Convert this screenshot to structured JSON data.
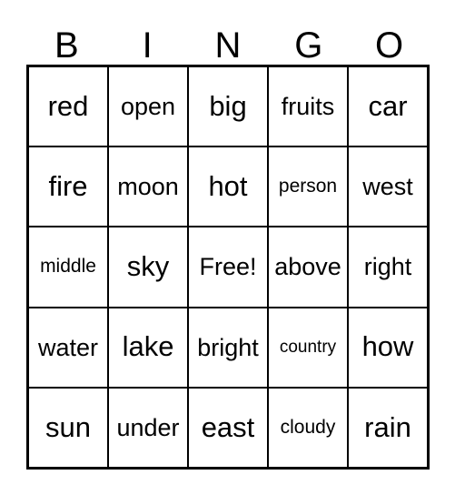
{
  "card": {
    "title": "BINGO",
    "header_letters": [
      "B",
      "I",
      "N",
      "G",
      "O"
    ],
    "border_color": "#000000",
    "background_color": "#ffffff",
    "text_color": "#000000",
    "rows": 5,
    "columns": 5,
    "free_space": "Free!",
    "grid": [
      [
        {
          "text": "red",
          "size": "lg"
        },
        {
          "text": "open",
          "size": "md"
        },
        {
          "text": "big",
          "size": "lg"
        },
        {
          "text": "fruits",
          "size": "md"
        },
        {
          "text": "car",
          "size": "lg"
        }
      ],
      [
        {
          "text": "fire",
          "size": "lg"
        },
        {
          "text": "moon",
          "size": "md"
        },
        {
          "text": "hot",
          "size": "lg"
        },
        {
          "text": "person",
          "size": "sm"
        },
        {
          "text": "west",
          "size": "md"
        }
      ],
      [
        {
          "text": "middle",
          "size": "sm"
        },
        {
          "text": "sky",
          "size": "lg"
        },
        {
          "text": "Free!",
          "size": "md"
        },
        {
          "text": "above",
          "size": "md"
        },
        {
          "text": "right",
          "size": "md"
        }
      ],
      [
        {
          "text": "water",
          "size": "md"
        },
        {
          "text": "lake",
          "size": "lg"
        },
        {
          "text": "bright",
          "size": "md"
        },
        {
          "text": "country",
          "size": "xs"
        },
        {
          "text": "how",
          "size": "lg"
        }
      ],
      [
        {
          "text": "sun",
          "size": "lg"
        },
        {
          "text": "under",
          "size": "md"
        },
        {
          "text": "east",
          "size": "lg"
        },
        {
          "text": "cloudy",
          "size": "sm"
        },
        {
          "text": "rain",
          "size": "lg"
        }
      ]
    ]
  }
}
